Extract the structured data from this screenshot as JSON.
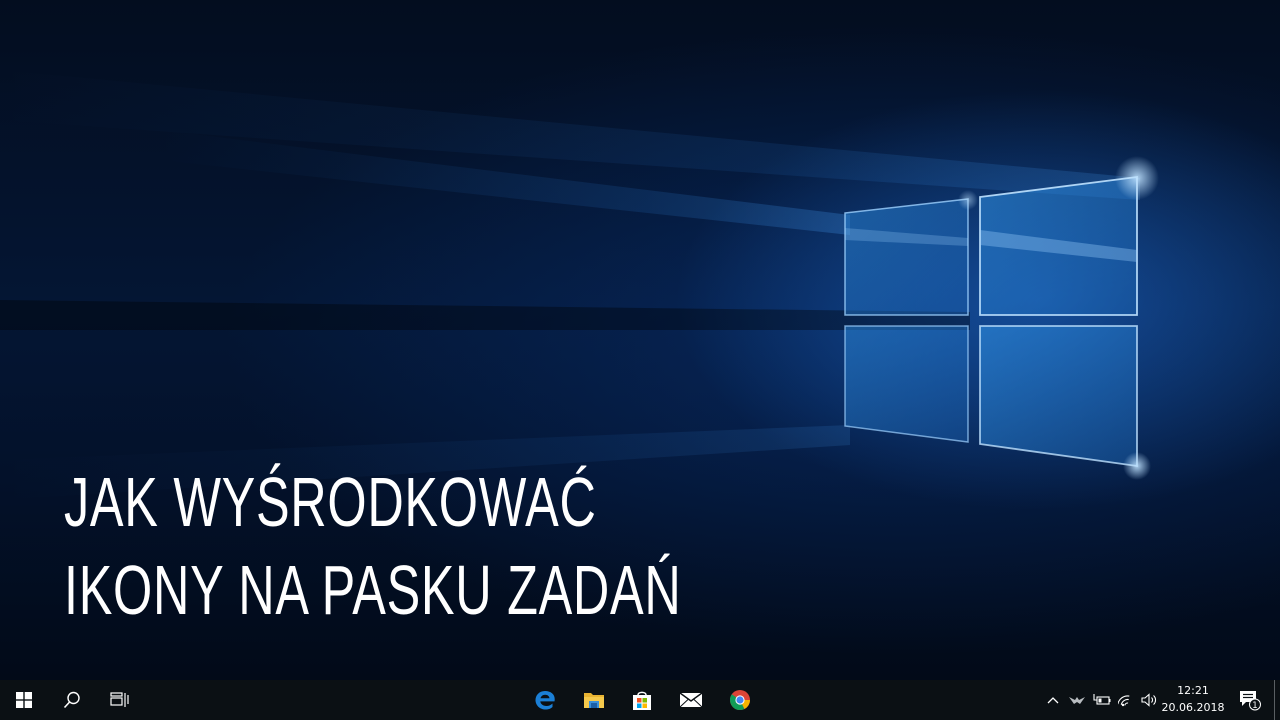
{
  "headline": {
    "line1": "JAK WYŚRODKOWAĆ",
    "line2": "IKONY NA PASKU ZADAŃ"
  },
  "taskbar": {
    "pinned": [
      {
        "name": "edge",
        "icon": "edge-icon"
      },
      {
        "name": "file-explorer",
        "icon": "folder-icon"
      },
      {
        "name": "store",
        "icon": "store-bag-icon"
      },
      {
        "name": "mail",
        "icon": "mail-icon"
      },
      {
        "name": "chrome",
        "icon": "chrome-icon"
      }
    ],
    "tray": {
      "time": "12:21",
      "date": "20.06.2018",
      "notification_count": "1"
    }
  },
  "colors": {
    "taskbar_bg": "#0b1014",
    "accent_blue": "#1b7fd6",
    "wallpaper_dark": "#030d1f"
  }
}
